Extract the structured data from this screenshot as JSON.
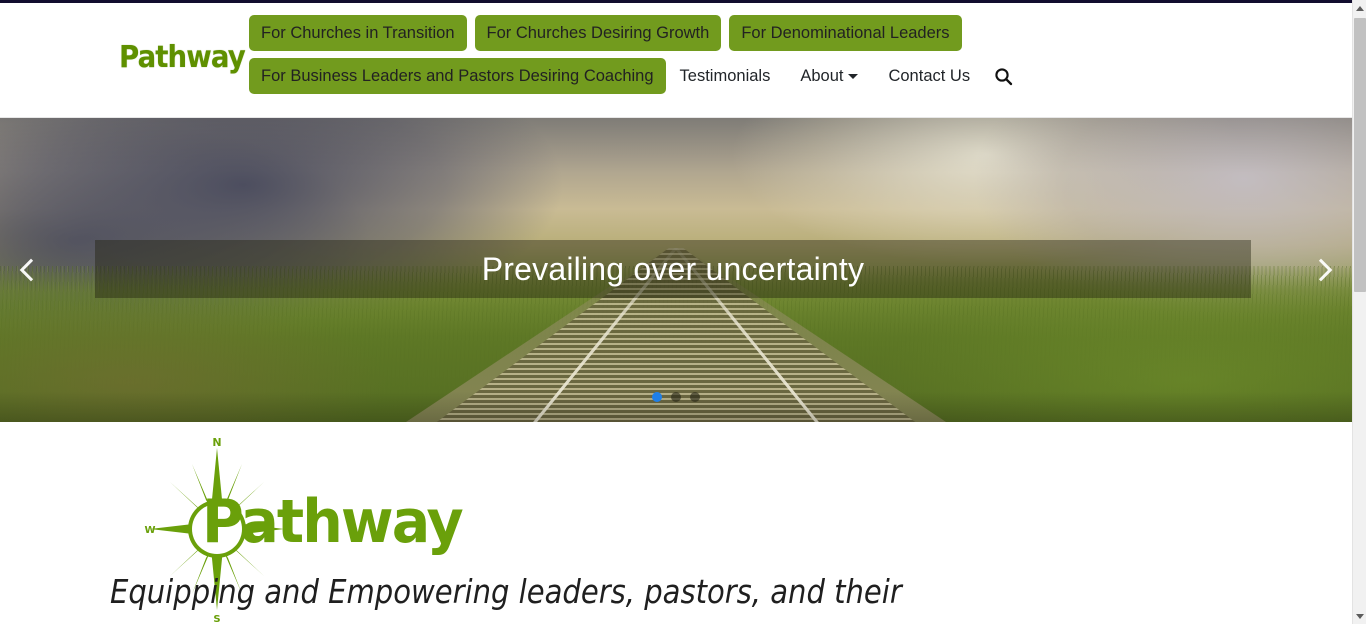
{
  "header": {
    "brand": "Pathway",
    "nav_pills": [
      "For Churches in Transition",
      "For Churches Desiring Growth",
      "For Denominational Leaders",
      "For Business Leaders and Pastors Desiring Coaching"
    ],
    "nav_links": [
      {
        "label": "Testimonials",
        "has_caret": false
      },
      {
        "label": "About",
        "has_caret": true
      },
      {
        "label": "Contact Us",
        "has_caret": false
      }
    ],
    "search_icon": "search-icon"
  },
  "hero": {
    "caption": "Prevailing over uncertainty",
    "prev_label": "‹",
    "next_label": "›",
    "slides": 3,
    "active_slide": 1,
    "accent_active_dot": "#1f7fe8",
    "band_color": "rgba(30,32,12,.42)"
  },
  "main": {
    "logo_word": "Pathway",
    "compass_labels": {
      "north": "N",
      "west": "W",
      "south": "S"
    },
    "tagline": "Equipping and Empowering leaders, pastors, and their"
  },
  "colors": {
    "brand_green": "#729b1e",
    "logo_green": "#6aa00a",
    "text_dark": "#212529"
  },
  "scrollbar": {
    "up_arrow": "scroll-up-icon",
    "down_arrow": "scroll-down-icon"
  }
}
